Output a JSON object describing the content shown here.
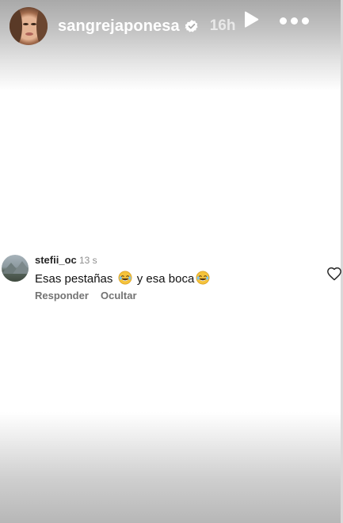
{
  "story": {
    "username": "sangrejaponesa",
    "time_ago": "16h",
    "icons": {
      "avatar": "profile-avatar",
      "verified": "verified-badge-icon",
      "play": "play-icon",
      "more": "more-options-icon"
    }
  },
  "comment": {
    "username": "stefii_oc",
    "time_ago": "13 s",
    "text_part1": "Esas pestañas",
    "text_part2": "y esa boca",
    "emoji": "face-with-tears-of-joy",
    "reply_label": "Responder",
    "hide_label": "Ocultar",
    "like_icon": "heart-icon"
  },
  "colors": {
    "top_gradient": "#a9a9a9",
    "bottom_gradient": "#b7b7b7",
    "text_primary": "#262626",
    "text_secondary": "#737373"
  }
}
